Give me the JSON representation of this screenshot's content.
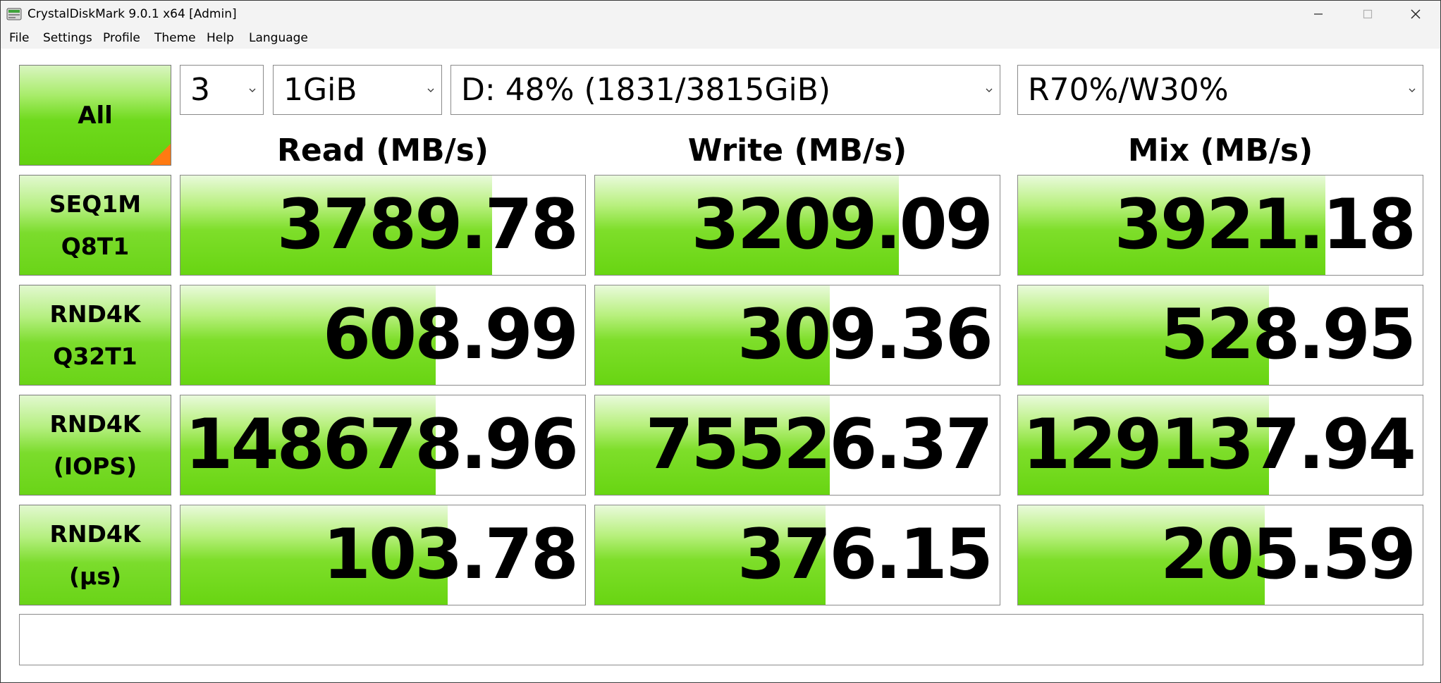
{
  "window": {
    "title": "CrystalDiskMark 9.0.1 x64 [Admin]",
    "controls": [
      "minimize-icon",
      "maximize-icon",
      "close-icon"
    ]
  },
  "menu": {
    "file": "File",
    "settings": "Settings",
    "profile": "Profile",
    "theme": "Theme",
    "help": "Help",
    "language": "Language"
  },
  "toolbar": {
    "all_label": "All",
    "count": "3",
    "size": "1GiB",
    "drive": "D: 48% (1831/3815GiB)",
    "mix": "R70%/W30%"
  },
  "headers": {
    "read": "Read (MB/s)",
    "write": "Write (MB/s)",
    "mix": "Mix (MB/s)"
  },
  "rows": [
    {
      "label1": "SEQ1M",
      "label2": "Q8T1",
      "read": "3789.78",
      "write": "3209.09",
      "mix": "3921.18",
      "read_fill": 0.77,
      "write_fill": 0.75,
      "mix_fill": 0.76
    },
    {
      "label1": "RND4K",
      "label2": "Q32T1",
      "read": "608.99",
      "write": "309.36",
      "mix": "528.95",
      "read_fill": 0.63,
      "write_fill": 0.58,
      "mix_fill": 0.62
    },
    {
      "label1": "RND4K",
      "label2": "(IOPS)",
      "read": "148678.96",
      "write": "75526.37",
      "mix": "129137.94",
      "read_fill": 0.63,
      "write_fill": 0.58,
      "mix_fill": 0.62
    },
    {
      "label1": "RND4K",
      "label2": "(µs)",
      "read": "103.78",
      "write": "376.15",
      "mix": "205.59",
      "read_fill": 0.66,
      "write_fill": 0.57,
      "mix_fill": 0.61
    }
  ],
  "comment": "",
  "colors": {
    "accent_green": "#68d512",
    "corner_orange": "#ff7a12"
  }
}
